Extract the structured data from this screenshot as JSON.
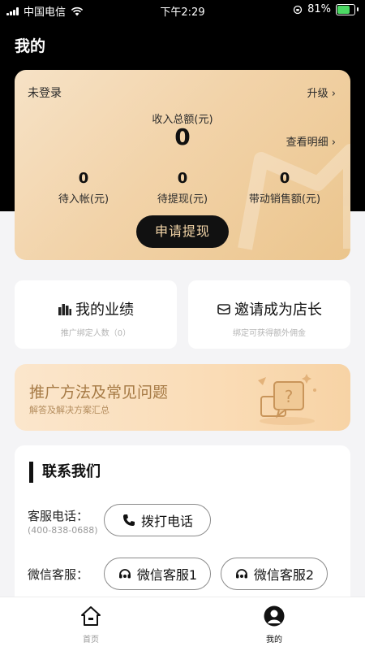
{
  "status_bar": {
    "carrier": "中国电信",
    "time": "下午2:29",
    "battery_percent": "81%",
    "battery_level": 0.81,
    "icons": [
      "signal-icon",
      "wifi-icon",
      "rotation-lock-icon",
      "battery-icon"
    ]
  },
  "header": {
    "title": "我的"
  },
  "earnings_card": {
    "login_status": "未登录",
    "upgrade_label": "升级",
    "total_income_label": "收入总额(元)",
    "total_income_value": "0",
    "view_detail_label": "查看明细",
    "stats": [
      {
        "value": "0",
        "label": "待入帐(元)"
      },
      {
        "value": "0",
        "label": "待提现(元)"
      },
      {
        "value": "0",
        "label": "带动销售额(元)"
      }
    ],
    "withdraw_button": "申请提现"
  },
  "features": [
    {
      "title": "我的业绩",
      "subtitle": "推广绑定人数（0）",
      "icon": "bar-chart-icon"
    },
    {
      "title": "邀请成为店长",
      "subtitle": "绑定可获得额外佣金",
      "icon": "envelope-icon"
    }
  ],
  "faq_banner": {
    "title": "推广方法及常见问题",
    "subtitle": "解答及解决方案汇总",
    "icon": "question-chat-icon"
  },
  "contact": {
    "heading": "联系我们",
    "phone_label": "客服电话：",
    "phone_number": "(400-838-0688)",
    "call_button": "拨打电话",
    "wechat_label": "微信客服：",
    "wechat_buttons": [
      "微信客服1",
      "微信客服2"
    ]
  },
  "tab_bar": {
    "items": [
      {
        "label": "首页",
        "icon": "home-icon",
        "active": false
      },
      {
        "label": "我的",
        "icon": "user-icon",
        "active": true
      }
    ]
  },
  "colors": {
    "gold_light": "#f6e2c6",
    "gold_dark": "#ebc58d",
    "button_text_gold": "#f3d5a8",
    "faq_title": "#a67a45",
    "battery_green": "#4cd964"
  }
}
